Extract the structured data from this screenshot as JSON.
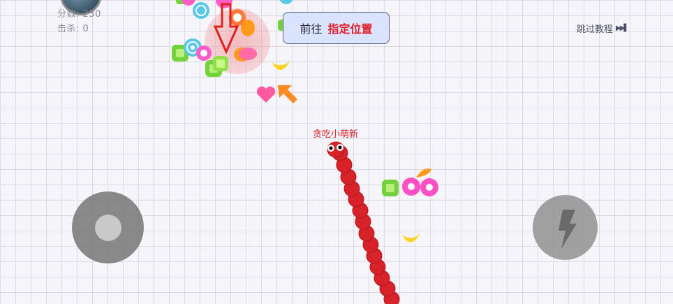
{
  "hud": {
    "score_label": "分数",
    "score_value": "230",
    "kills_label": "击杀",
    "kills_value": "0",
    "separator": ":"
  },
  "objective": {
    "prefix": "前往",
    "target": "指定位置"
  },
  "skip": {
    "label": "跳过教程",
    "icon": "fast-forward-icon"
  },
  "player": {
    "name": "贪吃小萌新",
    "color": "#d8222a"
  },
  "controls": {
    "joystick_icon": "joystick",
    "boost_icon": "lightning-icon"
  },
  "colors": {
    "banner_bg": "#dbe4ff",
    "banner_target_text": "#e0202a",
    "snake_body": "#d8222a"
  }
}
